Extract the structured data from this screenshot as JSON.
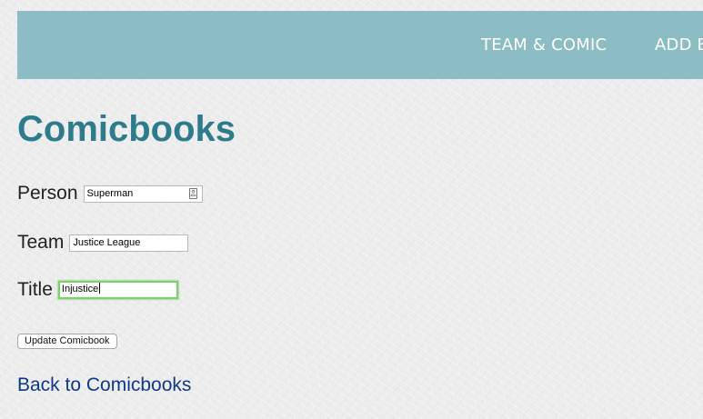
{
  "nav": {
    "items": [
      {
        "label": "TEAM & COMIC"
      },
      {
        "label": "ADD B"
      }
    ]
  },
  "page": {
    "title": "Comicbooks"
  },
  "form": {
    "person": {
      "label": "Person",
      "value": "Superman"
    },
    "team": {
      "label": "Team",
      "value": "Justice League"
    },
    "title": {
      "label": "Title",
      "value": "Injustice"
    },
    "submit_label": "Update Comicbook"
  },
  "back_link": {
    "label": "Back to Comicbooks"
  },
  "colors": {
    "navbar_bg": "#8cbcc4",
    "title_color": "#2e7b8c",
    "link_color": "#0f3a87",
    "focus_ring": "#7bd16b"
  },
  "icons": {
    "autofill": "contact-card-icon"
  }
}
